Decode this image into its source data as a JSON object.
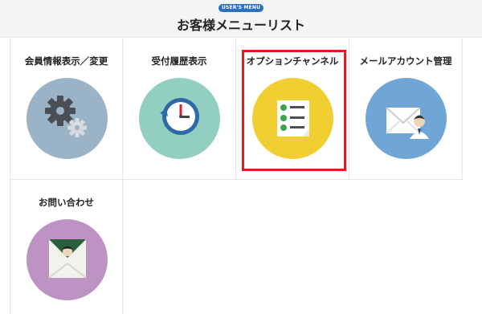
{
  "header": {
    "badge": "USER'S MENU",
    "title": "お客様メニューリスト"
  },
  "menu": {
    "items": [
      {
        "label": "会員情報表示／変更",
        "icon": "gears-icon",
        "color": "#9bb3c6"
      },
      {
        "label": "受付履歴表示",
        "icon": "history-clock-icon",
        "color": "#93cfc0"
      },
      {
        "label": "オプションチャンネル",
        "icon": "checklist-icon",
        "color": "#f1cf33"
      },
      {
        "label": "メールアカウント管理",
        "icon": "mail-user-icon",
        "color": "#70a6d6"
      },
      {
        "label": "お問い合わせ",
        "icon": "envelope-person-icon",
        "color": "#bd93c3"
      }
    ],
    "selected_index": 2,
    "highlight_color": "#e01b24"
  }
}
